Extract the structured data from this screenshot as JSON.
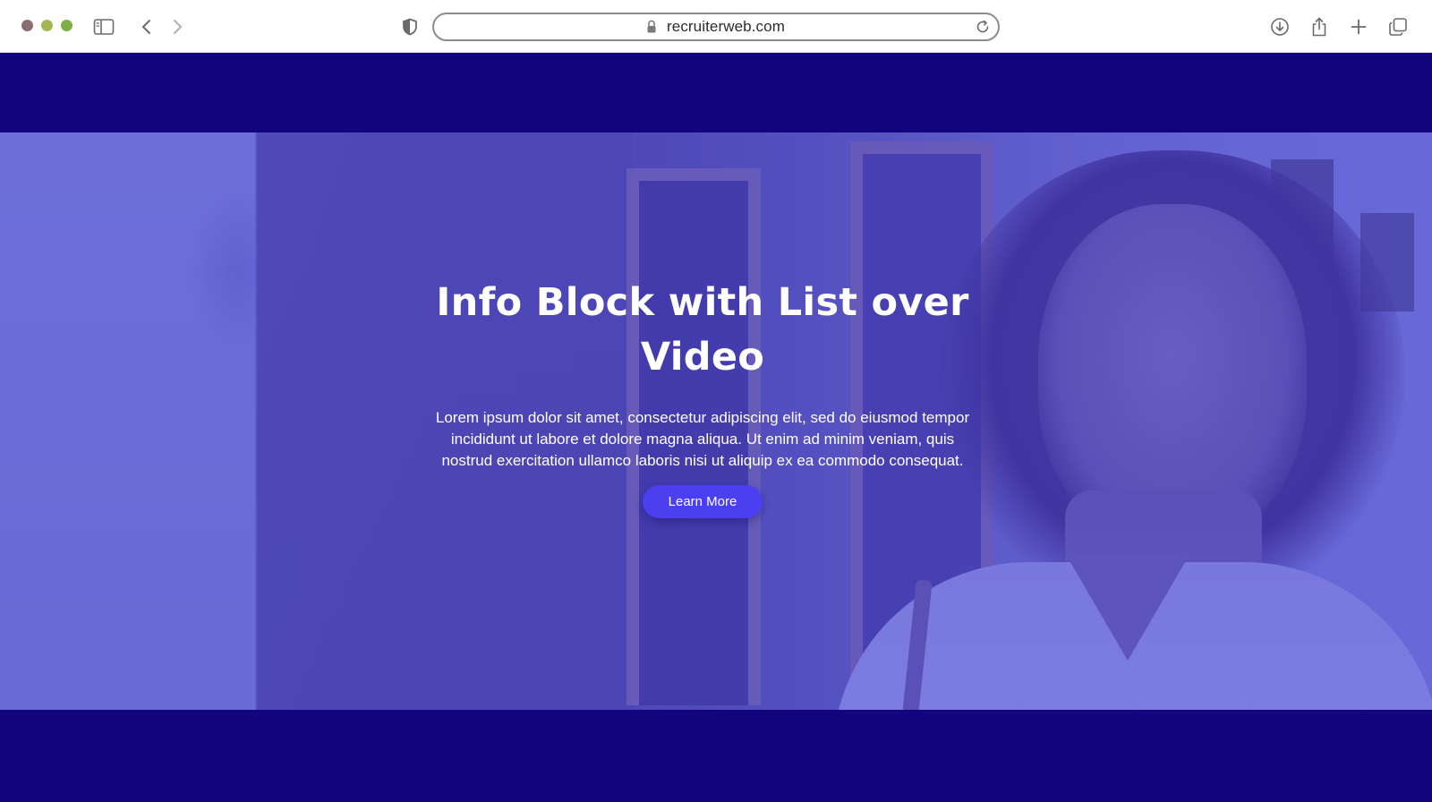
{
  "browser": {
    "traffic_lights": {
      "close_color": "#8a6e72",
      "minimize_color": "#a3b84f",
      "maximize_color": "#7db046"
    },
    "address_bar": {
      "url": "recruiterweb.com"
    },
    "icons": {
      "sidebar": "sidebar-icon",
      "back": "chevron-left-icon",
      "forward": "chevron-right-icon",
      "privacy": "shield-icon",
      "lock": "lock-icon",
      "reload": "reload-icon",
      "download": "download-icon",
      "share": "share-icon",
      "new_tab": "plus-icon",
      "tabs": "tabs-icon"
    }
  },
  "page": {
    "background_color": "#12047c",
    "hero": {
      "title": "Info Block with List over Video",
      "description": "Lorem ipsum dolor sit amet, consectetur adipiscing elit, sed do eiusmod tempor incididunt ut labore et dolore magna aliqua. Ut enim ad minim veniam, quis nostrud exercitation ullamco laboris nisi ut aliquip ex ea commodo consequat.",
      "cta_label": "Learn More",
      "cta_color": "#4b3ff0",
      "overlay_color": "#6b6cd9"
    }
  }
}
